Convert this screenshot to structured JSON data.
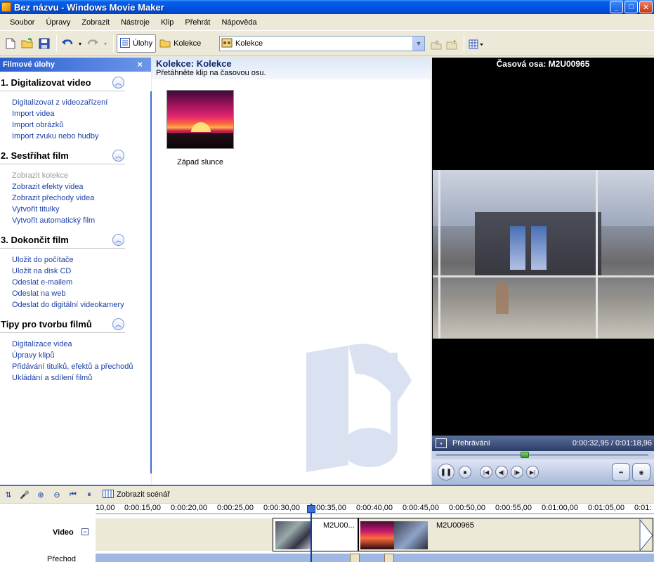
{
  "window": {
    "title": "Bez názvu - Windows Movie Maker",
    "min_label": "_",
    "max_label": "□",
    "close_label": "✕"
  },
  "menu": [
    "Soubor",
    "Úpravy",
    "Zobrazit",
    "Nástroje",
    "Klip",
    "Přehrát",
    "Nápověda"
  ],
  "toolbar": {
    "tasks_label": "Úlohy",
    "collections_label": "Kolekce",
    "dropdown_value": "Kolekce"
  },
  "tasks": {
    "header": "Filmové úlohy",
    "close": "×",
    "collapse_glyph": "︿",
    "sections": [
      {
        "title": "1. Digitalizovat video",
        "links": [
          "Digitalizovat z videozařízení",
          "Import videa",
          "Import obrázků",
          "Import zvuku nebo hudby"
        ]
      },
      {
        "title": "2. Sestříhat film",
        "links": [
          "Zobrazit kolekce",
          "Zobrazit efekty videa",
          "Zobrazit přechody videa",
          "Vytvořit titulky",
          "Vytvořit automatický film"
        ]
      },
      {
        "title": "3. Dokončit film",
        "links": [
          "Uložit do počítače",
          "Uložit na disk CD",
          "Odeslat e-mailem",
          "Odeslat na web",
          "Odeslat do digitální videokamery"
        ]
      },
      {
        "title": "Tipy pro tvorbu filmů",
        "links": [
          "Digitalizace videa",
          "Úpravy klipů",
          "Přidávání titulků, efektů a přechodů",
          "Ukládání a sdílení filmů"
        ]
      }
    ]
  },
  "collection": {
    "title": "Kolekce: Kolekce",
    "subtitle": "Přetáhněte klip na časovou osu.",
    "clip_label": "Západ slunce"
  },
  "preview": {
    "title": "Časová osa: M2U00965",
    "mode": "Přehrávání",
    "time": "0:00:32,95 / 0:01:18,96",
    "seek_fraction": 0.417
  },
  "timeline": {
    "storyboard_label": "Zobrazit scénář",
    "ruler": [
      "10,00",
      "0:00:15,00",
      "0:00:20,00",
      "0:00:25,00",
      "0:00:30,00",
      "0:00:35,00",
      "0:00:40,00",
      "0:00:45,00",
      "0:00:50,00",
      "0:00:55,00",
      "0:01:00,00",
      "0:01:05,00",
      "0:01:"
    ],
    "video_label": "Video",
    "expand_glyph": "−",
    "transition_label": "Přechod",
    "clip_a": "M2U00...",
    "clip_b": "M2U00965"
  },
  "colors": {
    "accent": "#3a6fd6",
    "title_bar": "#0055e5",
    "link": "#1b3fa8"
  }
}
